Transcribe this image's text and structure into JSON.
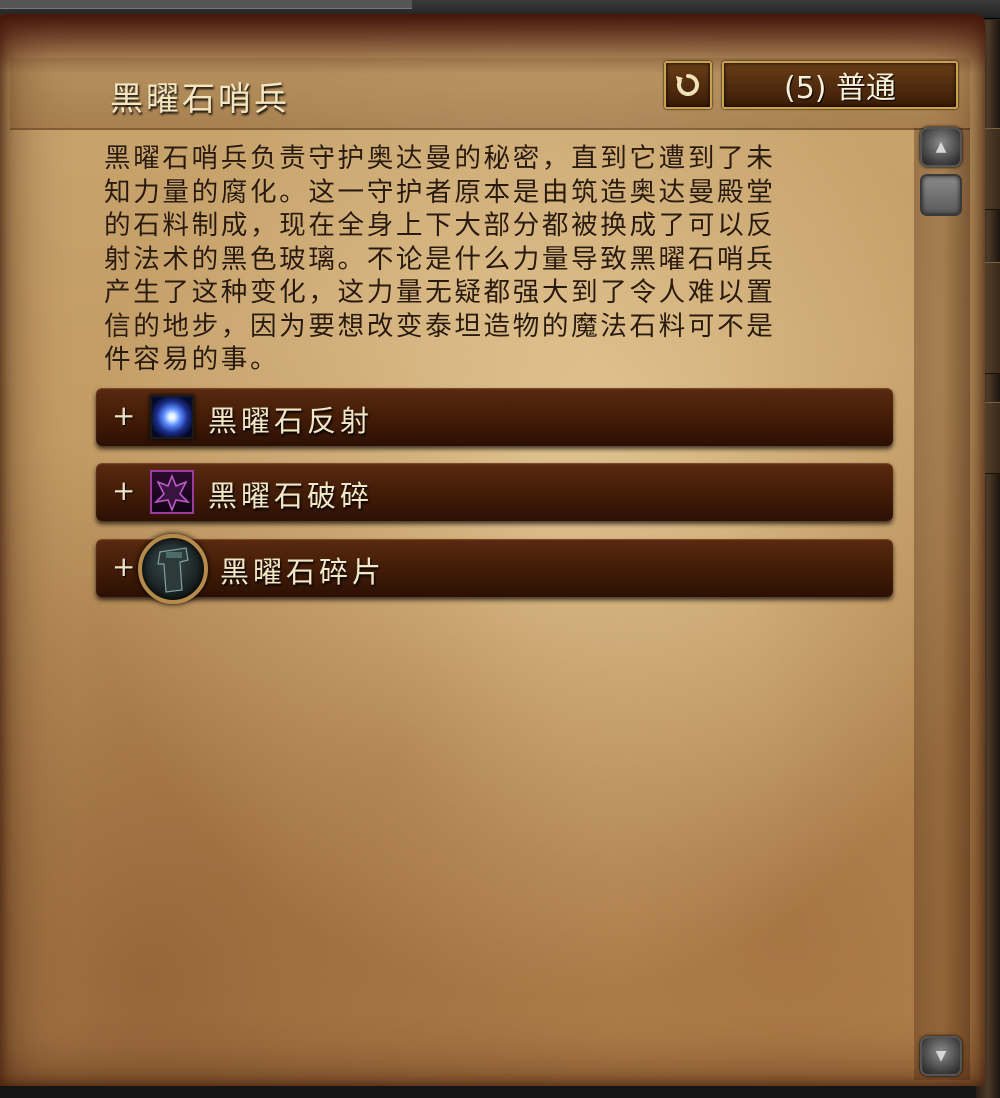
{
  "header": {
    "title": "黑曜石哨兵",
    "difficulty_label": "(5) 普通"
  },
  "description": {
    "lines": [
      "黑曜石哨兵负责守护奥达曼的秘密，直到它遭到了未",
      "知力量的腐化。这一守护者原本是由筑造奥达曼殿堂",
      "的石料制成，现在全身上下大部分都被换成了可以反",
      "射法术的黑色玻璃。不论是什么力量导致黑曜石哨兵",
      "产生了这种变化，这力量无疑都强大到了令人难以置",
      "信的地步，因为要想改变泰坦造物的魔法石料可不是",
      "件容易的事。"
    ]
  },
  "abilities": [
    {
      "expand": "+",
      "label": "黑曜石反射",
      "icon": "obsidian-reflection-icon"
    },
    {
      "expand": "+",
      "label": "黑曜石破碎",
      "icon": "obsidian-shatter-icon"
    },
    {
      "expand": "+",
      "label": "黑曜石碎片",
      "icon": "obsidian-shard-icon"
    }
  ],
  "icons": {
    "reset": "reset-arrow-icon",
    "scroll_up": "scroll-up-arrow-icon",
    "scroll_down": "scroll-down-arrow-icon"
  },
  "colors": {
    "title_text": "#f3e6c0",
    "body_text": "#2a1a0c",
    "row_background": "#4a200a",
    "button_border": "#c9a24a"
  }
}
